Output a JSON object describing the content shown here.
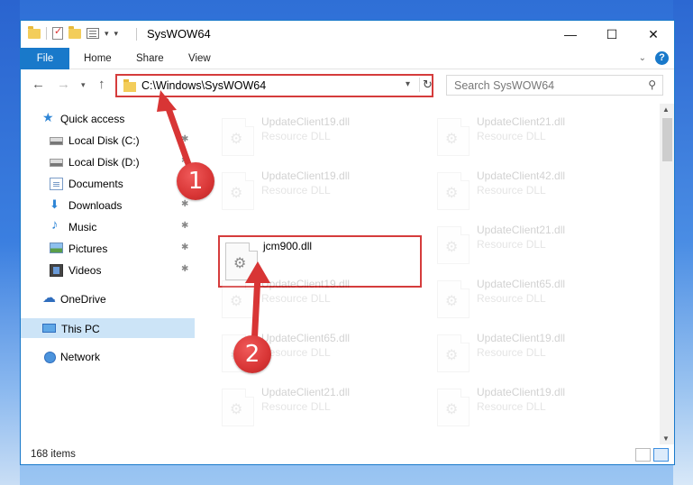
{
  "window": {
    "title": "SysWOW64"
  },
  "ribbon": {
    "tabs": [
      "File",
      "Home",
      "Share",
      "View"
    ]
  },
  "address": {
    "path": "C:\\Windows\\SysWOW64",
    "search_placeholder": "Search SysWOW64"
  },
  "nav": {
    "items": [
      {
        "label": "Quick access",
        "icon": "star-icon",
        "pinned": false
      },
      {
        "label": "Local Disk (C:)",
        "icon": "drive-icon",
        "pinned": true
      },
      {
        "label": "Local Disk (D:)",
        "icon": "drive-icon",
        "pinned": true
      },
      {
        "label": "Documents",
        "icon": "documents-icon",
        "pinned": true
      },
      {
        "label": "Downloads",
        "icon": "downloads-icon",
        "pinned": true
      },
      {
        "label": "Music",
        "icon": "music-icon",
        "pinned": true
      },
      {
        "label": "Pictures",
        "icon": "pictures-icon",
        "pinned": true
      },
      {
        "label": "Videos",
        "icon": "videos-icon",
        "pinned": true
      },
      {
        "label": "OneDrive",
        "icon": "onedrive-icon",
        "pinned": false
      },
      {
        "label": "This PC",
        "icon": "computer-icon",
        "pinned": false,
        "selected": true
      },
      {
        "label": "Network",
        "icon": "network-icon",
        "pinned": false
      }
    ]
  },
  "files": {
    "left_column": [
      {
        "name": "UpdateClient19.dll",
        "type": "Resource DLL",
        "faded": true
      },
      {
        "name": "UpdateClient19.dll",
        "type": "Resource DLL",
        "faded": true
      },
      {
        "name": "jcm900.dll",
        "type": "",
        "faded": false,
        "highlighted": true
      },
      {
        "name": "UpdateClient19.dll",
        "type": "Resource DLL",
        "faded": true
      },
      {
        "name": "UpdateClient65.dll",
        "type": "Resource DLL",
        "faded": true
      },
      {
        "name": "UpdateClient21.dll",
        "type": "Resource DLL",
        "faded": true
      }
    ],
    "right_column": [
      {
        "name": "UpdateClient21.dll",
        "type": "Resource DLL",
        "faded": true
      },
      {
        "name": "UpdateClient42.dll",
        "type": "Resource DLL",
        "faded": true
      },
      {
        "name": "UpdateClient21.dll",
        "type": "Resource DLL",
        "faded": true
      },
      {
        "name": "UpdateClient65.dll",
        "type": "Resource DLL",
        "faded": true
      },
      {
        "name": "UpdateClient19.dll",
        "type": "Resource DLL",
        "faded": true
      },
      {
        "name": "UpdateClient19.dll",
        "type": "Resource DLL",
        "faded": true
      }
    ]
  },
  "status": {
    "item_count": "168 items"
  },
  "annotations": {
    "step1": "1",
    "step2": "2",
    "color": "#d83535"
  },
  "colors": {
    "accent": "#1979ca",
    "highlight_border": "#d53c3c",
    "selection": "#cce4f7"
  }
}
